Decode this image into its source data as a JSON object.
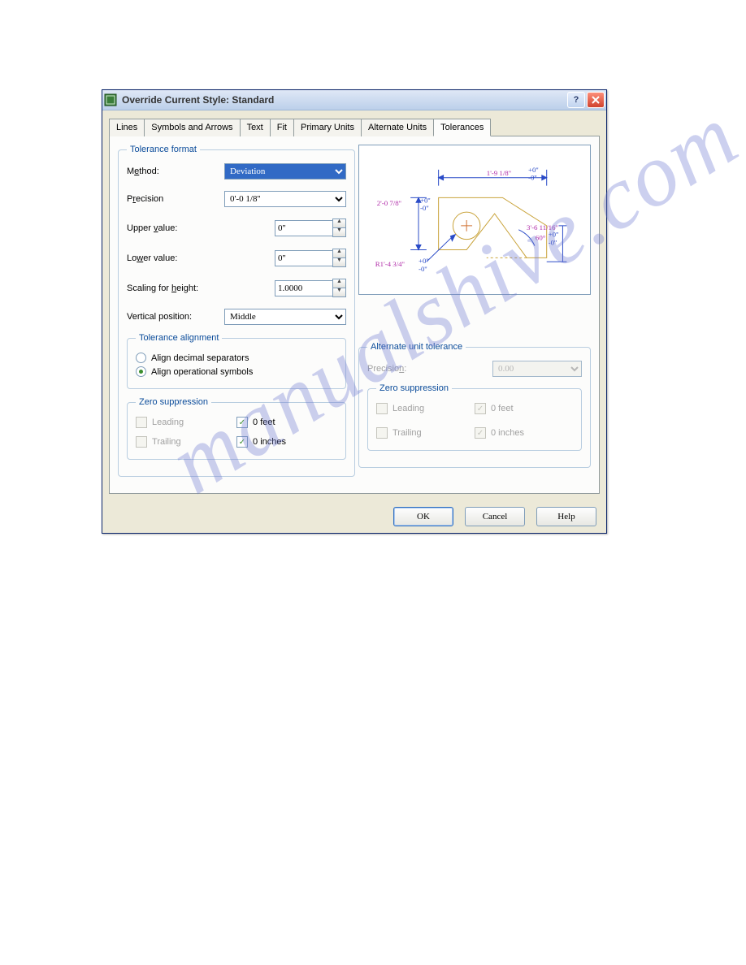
{
  "watermark": "manualshive.com",
  "dialog": {
    "title": "Override Current Style: Standard"
  },
  "tabs": {
    "t0": "Lines",
    "t1": "Symbols and Arrows",
    "t2": "Text",
    "t3": "Fit",
    "t4": "Primary Units",
    "t5": "Alternate Units",
    "t6": "Tolerances"
  },
  "tf": {
    "legend": "Tolerance format",
    "method_lbl_pre": "M",
    "method_lbl_u": "e",
    "method_lbl_post": "thod:",
    "method_val": "Deviation",
    "precision_lbl_pre": "P",
    "precision_lbl_u": "r",
    "precision_lbl_post": "ecision",
    "precision_val": "0'-0 1/8''",
    "upper_lbl_pre": "Upper ",
    "upper_lbl_u": "v",
    "upper_lbl_post": "alue:",
    "upper_val": "0''",
    "lower_lbl_pre": "Lo",
    "lower_lbl_u": "w",
    "lower_lbl_post": "er value:",
    "lower_val": "0''",
    "scale_lbl_pre": "Scaling for ",
    "scale_lbl_u": "h",
    "scale_lbl_post": "eight:",
    "scale_val": "1.0000",
    "vpos_lbl": "Vertical position:",
    "vpos_val": "Middle"
  },
  "ta": {
    "legend": "Tolerance alignment",
    "r1_pre": "A",
    "r1_u": "l",
    "r1_post": "ign decimal separators",
    "r2_pre": "Ali",
    "r2_u": "g",
    "r2_post": "n operational symbols"
  },
  "zs": {
    "legend": "Zero suppression",
    "leading_pre": "L",
    "leading_u": "e",
    "leading_post": "ading",
    "trailing_pre": "T",
    "trailing_u": "r",
    "trailing_post": "ailing",
    "feet_pre": "0 ",
    "feet_u": "f",
    "feet_post": "eet",
    "inches_pre": "0 ",
    "inches_u": "i",
    "inches_post": "nches"
  },
  "au": {
    "legend": "Alternate unit tolerance",
    "prec_lbl_pre": "Precisio",
    "prec_lbl_u": "n",
    "prec_lbl_post": ":",
    "prec_val": "0.00"
  },
  "auzs": {
    "legend": "Zero suppression",
    "leading_pre": "Leadin",
    "leading_u": "g",
    "leading_post": "",
    "trailing_pre": "Trailin",
    "trailing_u": "g",
    "trailing_post": "",
    "feet": "0 feet",
    "inches": "0 inches"
  },
  "btn": {
    "ok": "OK",
    "cancel": "Cancel",
    "help_pre": "",
    "help_u": "H",
    "help_post": "elp"
  },
  "preview": {
    "d1": "1'-9 1/8''",
    "d2": "2'-0 7/8''",
    "d3": "3'-6 11/16''",
    "dtol_up": "+0''",
    "dtol_dn": "-0''",
    "r1": "R1'-4 3/4''",
    "a1": "60°"
  }
}
